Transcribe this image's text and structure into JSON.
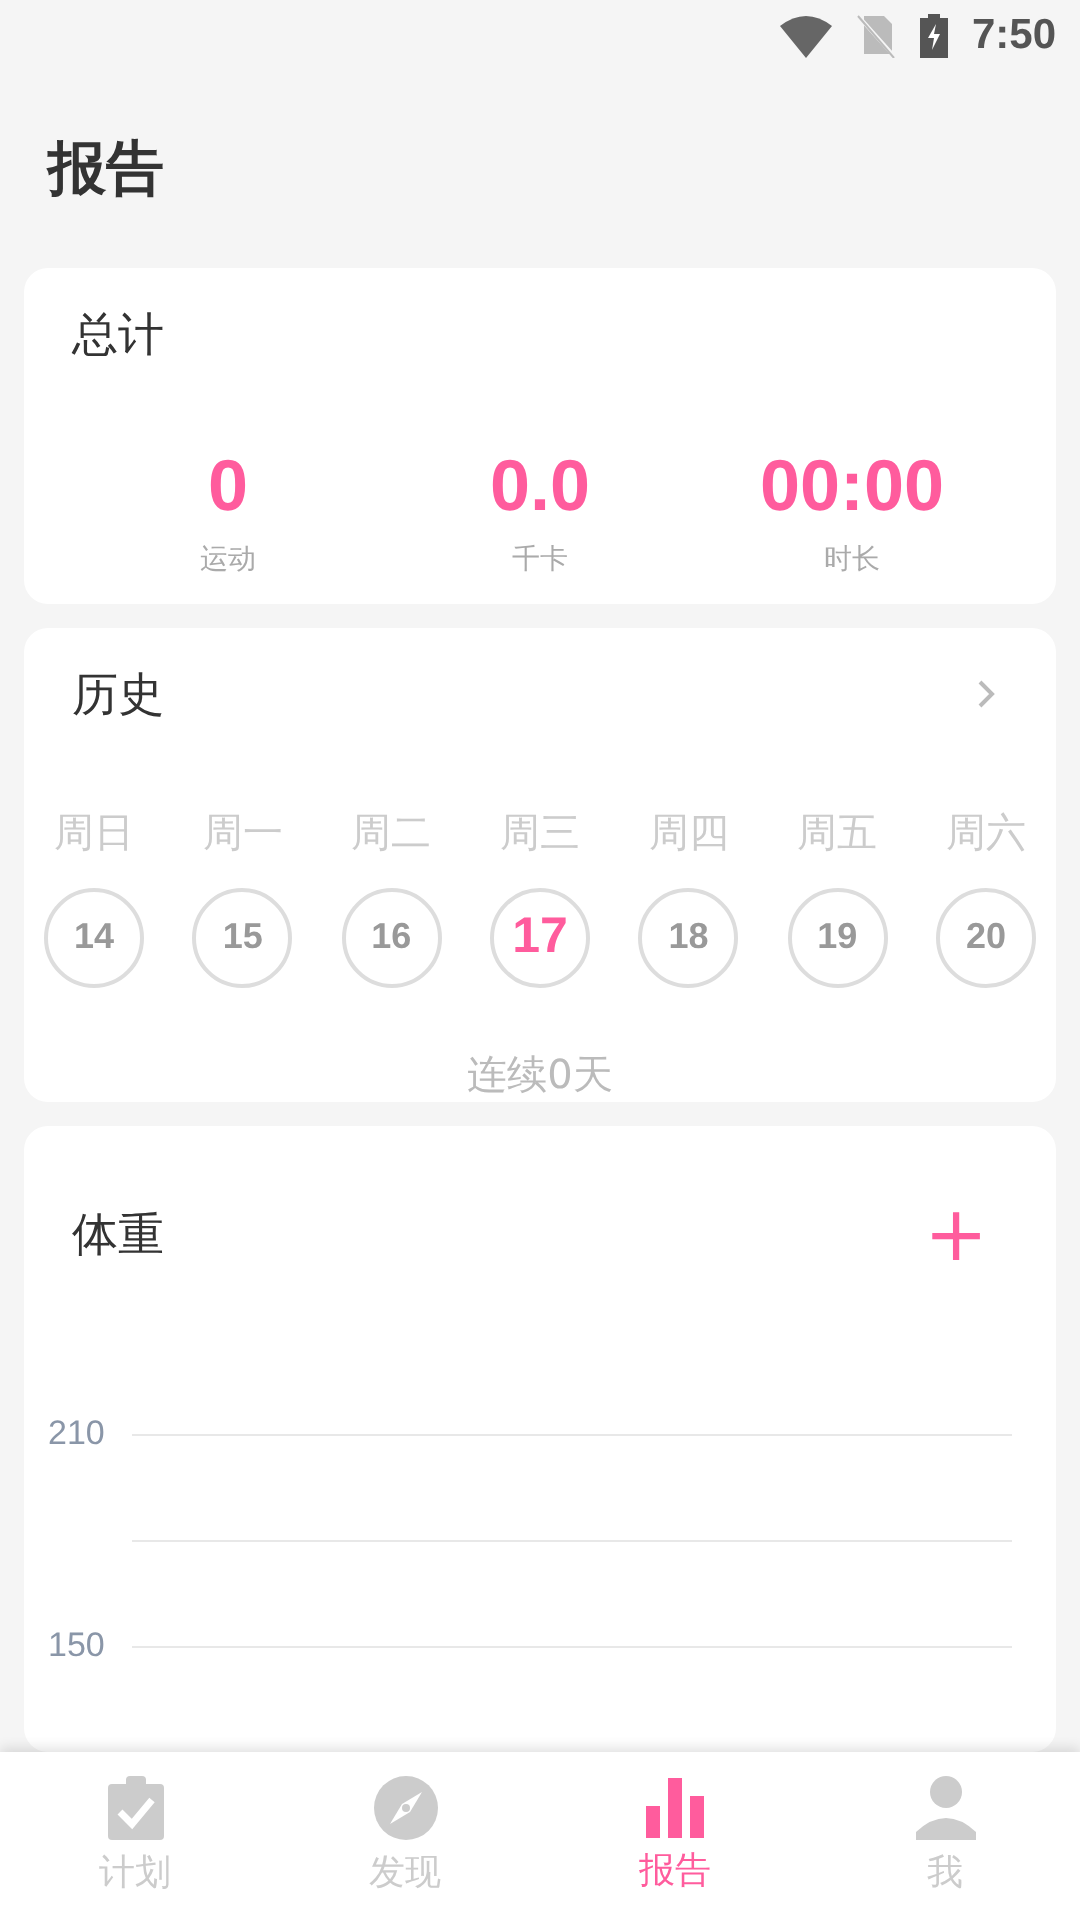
{
  "status_bar": {
    "time": "7:50"
  },
  "header": {
    "title": "报告"
  },
  "summary": {
    "title": "总计",
    "stats": [
      {
        "value": "0",
        "label": "运动"
      },
      {
        "value": "0.0",
        "label": "千卡"
      },
      {
        "value": "00:00",
        "label": "时长"
      }
    ]
  },
  "history": {
    "title": "历史",
    "days": [
      {
        "weekday": "周日",
        "date": "14",
        "selected": false
      },
      {
        "weekday": "周一",
        "date": "15",
        "selected": false
      },
      {
        "weekday": "周二",
        "date": "16",
        "selected": false
      },
      {
        "weekday": "周三",
        "date": "17",
        "selected": true
      },
      {
        "weekday": "周四",
        "date": "18",
        "selected": false
      },
      {
        "weekday": "周五",
        "date": "19",
        "selected": false
      },
      {
        "weekday": "周六",
        "date": "20",
        "selected": false
      }
    ],
    "streak": "连续0天"
  },
  "weight": {
    "title": "体重",
    "add_button": "+",
    "y_labels": [
      "210",
      "150"
    ]
  },
  "tab_bar": [
    {
      "label": "计划",
      "kind": "plan",
      "selected": false
    },
    {
      "label": "发现",
      "kind": "discover",
      "selected": false
    },
    {
      "label": "报告",
      "kind": "report",
      "selected": true
    },
    {
      "label": "我",
      "kind": "me",
      "selected": false
    }
  ]
}
